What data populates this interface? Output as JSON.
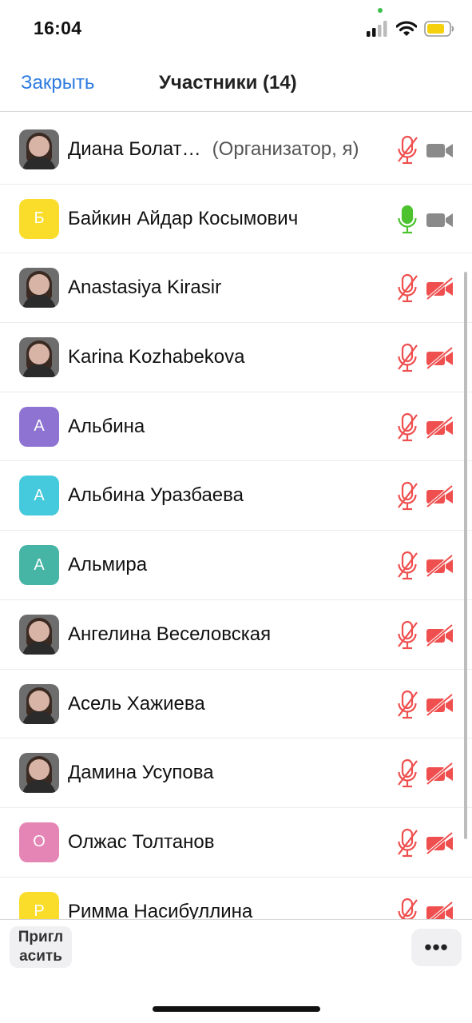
{
  "status": {
    "time": "16:04",
    "battery_color": "#f5d00f",
    "icons": [
      "signal-icon",
      "wifi-icon",
      "battery-icon"
    ]
  },
  "header": {
    "close_label": "Закрыть",
    "title": "Участники (14)"
  },
  "colors": {
    "accent": "#2d7be0",
    "muted_red": "#ef4f4f",
    "unmuted_green": "#4cc22e",
    "camera_gray": "#8a8a8a"
  },
  "participants": [
    {
      "name": "Диана Болат…",
      "role": "(Организатор, я)",
      "avatar": "photo",
      "initial": "",
      "color": "",
      "mic": "muted",
      "camera": "on"
    },
    {
      "name": "Байкин Айдар Косымович",
      "role": "",
      "avatar": "letter",
      "initial": "Б",
      "color": "#fadd2a",
      "mic": "on",
      "camera": "on"
    },
    {
      "name": "Anastasiya Kirasir",
      "role": "",
      "avatar": "photo",
      "initial": "",
      "color": "",
      "mic": "muted",
      "camera": "off"
    },
    {
      "name": "Karina Kozhabekova",
      "role": "",
      "avatar": "photo",
      "initial": "",
      "color": "",
      "mic": "muted",
      "camera": "off"
    },
    {
      "name": "Альбина",
      "role": "",
      "avatar": "letter",
      "initial": "А",
      "color": "#8e73d2",
      "mic": "muted",
      "camera": "off"
    },
    {
      "name": "Альбина Уразбаева",
      "role": "",
      "avatar": "letter",
      "initial": "А",
      "color": "#45c9dc",
      "mic": "muted",
      "camera": "off"
    },
    {
      "name": "Альмира",
      "role": "",
      "avatar": "letter",
      "initial": "А",
      "color": "#46b5a5",
      "mic": "muted",
      "camera": "off"
    },
    {
      "name": "Ангелина Веселовская",
      "role": "",
      "avatar": "photo",
      "initial": "",
      "color": "",
      "mic": "muted",
      "camera": "off"
    },
    {
      "name": "Асель Хажиева",
      "role": "",
      "avatar": "photo",
      "initial": "",
      "color": "",
      "mic": "muted",
      "camera": "off"
    },
    {
      "name": "Дамина Усупова",
      "role": "",
      "avatar": "photo",
      "initial": "",
      "color": "",
      "mic": "muted",
      "camera": "off"
    },
    {
      "name": "Олжас Толтанов",
      "role": "",
      "avatar": "letter",
      "initial": "О",
      "color": "#e585b5",
      "mic": "muted",
      "camera": "off"
    },
    {
      "name": "Римма Насибуллина",
      "role": "",
      "avatar": "letter",
      "initial": "Р",
      "color": "#fadd2a",
      "mic": "muted",
      "camera": "off"
    }
  ],
  "footer": {
    "invite_label": "Пригл асить",
    "more_label": "•••"
  }
}
